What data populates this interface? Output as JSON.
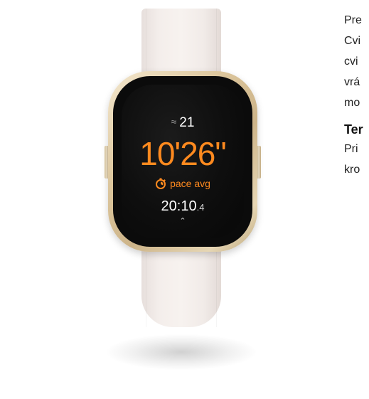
{
  "watch": {
    "floors_value": "21",
    "pace_value": "10'26\"",
    "pace_label": "pace avg",
    "elapsed_main": "20:10",
    "elapsed_sub": ".4",
    "colors": {
      "accent": "#ff8a1f",
      "band": "#f4eeeb",
      "case": "#d8c297",
      "screen": "#0e0e0e"
    },
    "icons": [
      "floors-chevron-icon",
      "stopwatch-icon",
      "chevron-up-icon"
    ]
  },
  "article": {
    "lines": [
      "Pre",
      "Cvi",
      "cvi",
      "vrá",
      "mo"
    ],
    "heading": "Ter",
    "lines2": [
      "Pri",
      "kro"
    ]
  }
}
